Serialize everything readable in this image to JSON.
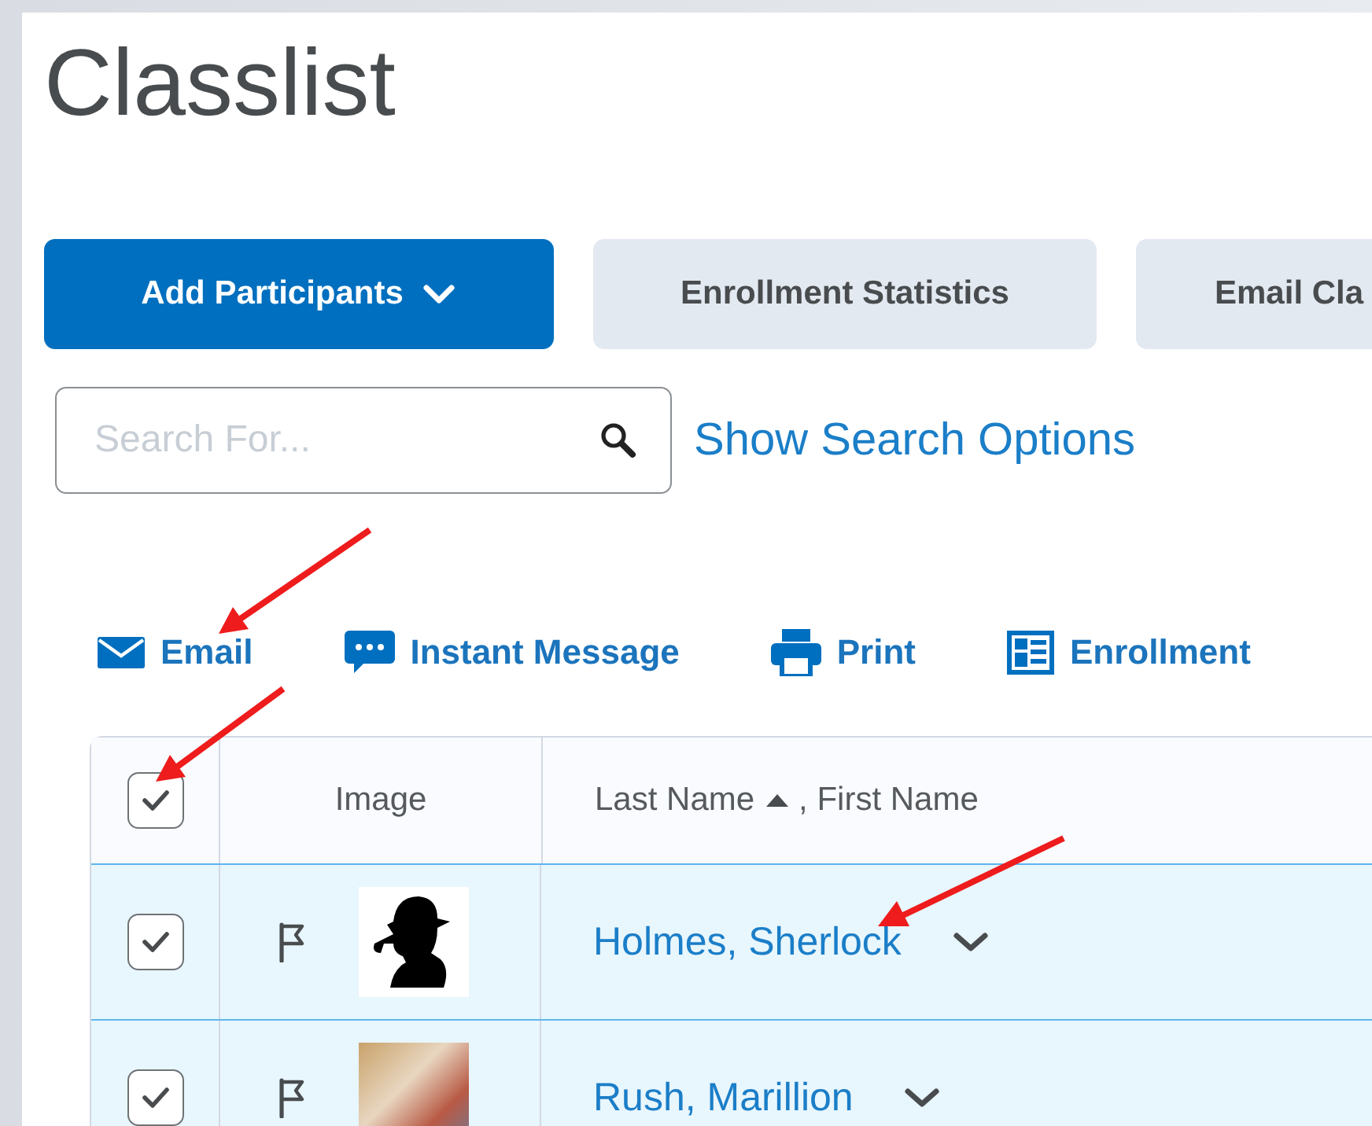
{
  "page": {
    "title": "Classlist"
  },
  "buttons": [
    {
      "label": "Add Participants",
      "kind": "primary",
      "dropdown": true
    },
    {
      "label": "Enrollment Statistics",
      "kind": "secondary",
      "dropdown": false
    },
    {
      "label": "Email Cla",
      "kind": "secondary"
    }
  ],
  "search": {
    "placeholder": "Search For...",
    "link": "Show Search Options"
  },
  "actions": [
    {
      "label": "Email"
    },
    {
      "label": "Instant Message"
    },
    {
      "label": "Print"
    },
    {
      "label": "Enrollment"
    }
  ],
  "table": {
    "select_all_checked": true,
    "image_header": "Image",
    "sort_column": "Last Name",
    "other_column": ", First Name",
    "rows": [
      {
        "name": "Holmes, Sherlock",
        "checked": true,
        "selected": true
      },
      {
        "name": "Rush, Marillion",
        "checked": true,
        "selected": true
      }
    ]
  }
}
